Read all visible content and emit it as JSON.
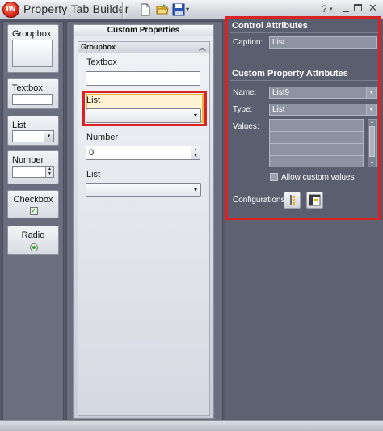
{
  "window": {
    "title": "Property Tab Builder",
    "logo_text": "IW",
    "help_label": "?",
    "help_arrow": "▾",
    "close_label": "✕",
    "qat_arrow": "▾"
  },
  "toolbox": {
    "items": [
      {
        "label": "Groupbox"
      },
      {
        "label": "Textbox"
      },
      {
        "label": "List"
      },
      {
        "label": "Number"
      },
      {
        "label": "Checkbox"
      },
      {
        "label": "Radio"
      }
    ],
    "check_glyph": "✓",
    "combo_arrow": "▾",
    "spin_up": "▲",
    "spin_down": "▼"
  },
  "designer": {
    "panel_title": "Custom Properties",
    "group_title": "Groupbox",
    "collapse_glyph": "︽",
    "combo_arrow": "▾",
    "spin_up": "▲",
    "spin_down": "▼",
    "fields": {
      "textbox_label": "Textbox",
      "textbox_value": "",
      "list1_label": "List",
      "number_label": "Number",
      "number_value": "0",
      "list2_label": "List"
    }
  },
  "properties": {
    "control_heading": "Control Attributes",
    "caption_label": "Caption:",
    "caption_value": "List",
    "custom_heading": "Custom Property Attributes",
    "name_label": "Name:",
    "name_value": "List9",
    "type_label": "Type:",
    "type_value": "List",
    "values_label": "Values:",
    "values_rows": [
      "",
      "",
      "",
      ""
    ],
    "combo_arrow": "▾",
    "scroll_up": "▲",
    "scroll_down": "▼",
    "allow_custom_label": "Allow custom values",
    "allow_custom_checked": false,
    "configurations_label": "Configurations:"
  },
  "colors": {
    "selection_red": "#d92222",
    "selection_gold": "#e9b43a",
    "panel_bg": "#5a5e6e"
  }
}
